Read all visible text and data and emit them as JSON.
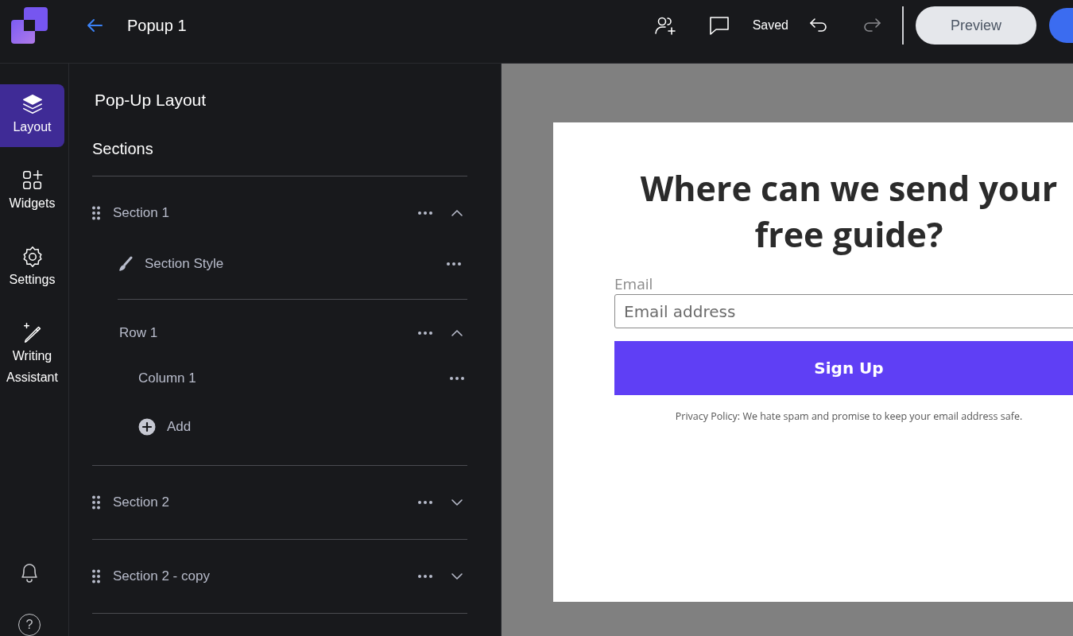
{
  "header": {
    "title": "Popup 1",
    "status": "Saved",
    "redo": {
      "disabled": true
    },
    "preview_button": "Preview"
  },
  "rail": {
    "items": [
      {
        "label": "Layout",
        "selected": true
      },
      {
        "label": "Widgets",
        "selected": false
      },
      {
        "label": "Settings",
        "selected": false
      },
      {
        "label": "Writing Assistant",
        "selected": false
      }
    ],
    "help": "?"
  },
  "panel": {
    "title": "Pop-Up Layout",
    "subtitle": "Sections",
    "sections": [
      {
        "label": "Section 1",
        "expanded": true,
        "children": [
          {
            "kind": "style",
            "label": "Section Style"
          },
          {
            "kind": "row",
            "label": "Row 1",
            "expanded": true,
            "children": [
              {
                "kind": "column",
                "label": "Column 1"
              },
              {
                "kind": "add",
                "label": "Add"
              }
            ]
          }
        ]
      },
      {
        "label": "Section 2",
        "expanded": false
      },
      {
        "label": "Section 2 - copy",
        "expanded": false
      }
    ]
  },
  "popup": {
    "heading": "Where can we send your free guide?",
    "field_label": "Email",
    "placeholder": "Email address",
    "button": "Sign Up",
    "privacy": "Privacy Policy: We hate spam and promise to keep your email address safe."
  }
}
